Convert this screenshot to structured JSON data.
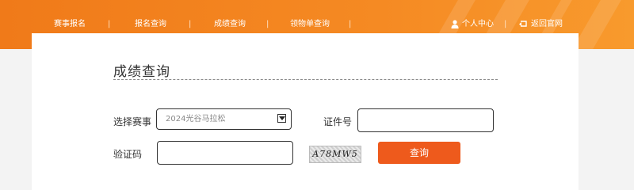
{
  "nav": {
    "items": [
      {
        "label": "赛事报名"
      },
      {
        "label": "报名查询"
      },
      {
        "label": "成绩查询"
      },
      {
        "label": "领物单查询"
      }
    ],
    "separator": "|",
    "user_center": "个人中心",
    "back_home": "返回官网"
  },
  "form": {
    "title": "成绩查询",
    "event_label": "选择赛事",
    "event_value": "2024光谷马拉松",
    "id_label": "证件号",
    "captcha_label": "验证码",
    "captcha_text": "A78MW5",
    "submit_label": "查询"
  },
  "colors": {
    "header": "#f07a19",
    "button": "#ee5a1c"
  },
  "icons": {
    "user": "user-icon",
    "back": "back-icon",
    "dropdown": "chevron-down-icon"
  }
}
